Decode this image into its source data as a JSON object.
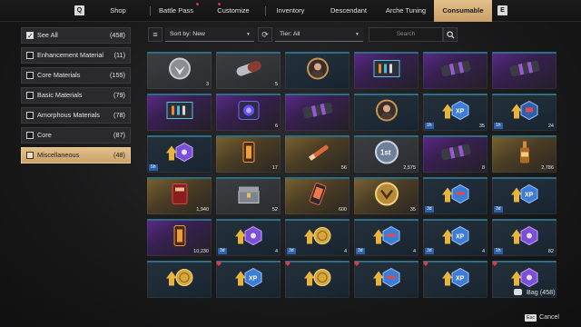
{
  "nav": {
    "left_key": "Q",
    "right_key": "E",
    "tabs": [
      {
        "label": "Shop",
        "dot": false
      },
      {
        "label": "Battle Pass",
        "dot": true
      },
      {
        "label": "Customize",
        "dot": true
      },
      {
        "label": "Inventory",
        "dot": false
      },
      {
        "label": "Descendant",
        "dot": false
      },
      {
        "label": "Arche Tuning",
        "dot": false
      },
      {
        "label": "Consumable",
        "dot": false,
        "active": true
      }
    ]
  },
  "sidebar": {
    "items": [
      {
        "label": "See All",
        "count": "(458)",
        "checked": true
      },
      {
        "label": "Enhancement Material",
        "count": "(11)"
      },
      {
        "label": "Core Materials",
        "count": "(155)"
      },
      {
        "label": "Basic Materials",
        "count": "(79)"
      },
      {
        "label": "Amorphous Materials",
        "count": "(78)"
      },
      {
        "label": "Core",
        "count": "(87)"
      },
      {
        "label": "Miscellaneous",
        "count": "(48)",
        "active": true
      }
    ]
  },
  "toolbar": {
    "sort_label": "Sort by: New",
    "tier_label": "Tier: All",
    "search_placeholder": "Search"
  },
  "grid": [
    [
      {
        "rarity": "gray",
        "icon": "emblem-icon",
        "qty": "3"
      },
      {
        "rarity": "gray",
        "icon": "capsule-icon",
        "qty": "5"
      },
      {
        "rarity": "blue",
        "icon": "portrait-icon",
        "qty": ""
      },
      {
        "rarity": "purple",
        "icon": "crate-icon",
        "qty": ""
      },
      {
        "rarity": "purple",
        "icon": "canister-icon",
        "qty": ""
      },
      {
        "rarity": "purple",
        "icon": "canister-icon",
        "qty": ""
      }
    ],
    [
      {
        "rarity": "purple",
        "icon": "crate-icon",
        "qty": ""
      },
      {
        "rarity": "purple",
        "icon": "device-icon",
        "qty": "6"
      },
      {
        "rarity": "purple",
        "icon": "canister-icon",
        "qty": ""
      },
      {
        "rarity": "blue",
        "icon": "portrait-icon",
        "qty": ""
      },
      {
        "rarity": "blue",
        "icon": "xp-boost-icon",
        "qty": "35",
        "tag": "1h"
      },
      {
        "rarity": "blue",
        "icon": "gold-boost-icon",
        "qty": "24",
        "tag": "1h"
      }
    ],
    [
      {
        "rarity": "blue",
        "icon": "mod-boost-icon",
        "qty": "",
        "tag": "5h"
      },
      {
        "rarity": "gold",
        "icon": "lantern-icon",
        "qty": "17"
      },
      {
        "rarity": "gold",
        "icon": "flare-icon",
        "qty": "56"
      },
      {
        "rarity": "gray",
        "icon": "first-medal-icon",
        "qty": "2,575"
      },
      {
        "rarity": "purple",
        "icon": "canister-icon",
        "qty": "8"
      },
      {
        "rarity": "gold",
        "icon": "bottle-icon",
        "qty": "2,786"
      }
    ],
    [
      {
        "rarity": "gold",
        "icon": "red-pack-icon",
        "qty": "1,940"
      },
      {
        "rarity": "gray",
        "icon": "chest-icon",
        "qty": "52"
      },
      {
        "rarity": "gold",
        "icon": "energy-cell-icon",
        "qty": "600"
      },
      {
        "rarity": "gold",
        "icon": "gold-coin-icon",
        "qty": "35"
      },
      {
        "rarity": "blue",
        "icon": "weapon-boost-icon",
        "qty": "",
        "tag": "3d"
      },
      {
        "rarity": "blue",
        "icon": "xp-boost-icon",
        "qty": "",
        "tag": "3d"
      }
    ],
    [
      {
        "rarity": "purple",
        "icon": "lantern-icon",
        "qty": "10,230"
      },
      {
        "rarity": "blue",
        "icon": "mod-boost-icon",
        "qty": "4",
        "tag": "3d"
      },
      {
        "rarity": "blue",
        "icon": "gold-coin-boost-icon",
        "qty": "4",
        "tag": "3d"
      },
      {
        "rarity": "blue",
        "icon": "weapon-boost-icon",
        "qty": "4",
        "tag": "3d"
      },
      {
        "rarity": "blue",
        "icon": "xp-boost-icon",
        "qty": "4",
        "tag": "3d"
      },
      {
        "rarity": "blue",
        "icon": "mod-boost-icon",
        "qty": "82",
        "tag": "1h"
      }
    ],
    [
      {
        "rarity": "blue",
        "icon": "gold-coin-boost-icon",
        "qty": ""
      },
      {
        "rarity": "blue",
        "icon": "xp-boost-icon",
        "qty": "",
        "pin": true
      },
      {
        "rarity": "blue",
        "icon": "gold-coin-boost-icon",
        "qty": "",
        "pin": true
      },
      {
        "rarity": "blue",
        "icon": "weapon-boost-icon",
        "qty": "",
        "pin": true
      },
      {
        "rarity": "blue",
        "icon": "xp-boost-icon",
        "qty": "",
        "pin": true
      },
      {
        "rarity": "blue",
        "icon": "mod-boost-icon",
        "qty": "",
        "pin": true
      }
    ]
  ],
  "footer": {
    "bag_label": "Bag (458)",
    "esc_key": "Esc",
    "cancel_label": "Cancel"
  },
  "colors": {
    "accent_gold": "#d8b47c",
    "tag_blue": "#2f5fa8",
    "alert_red": "#e0304a"
  }
}
